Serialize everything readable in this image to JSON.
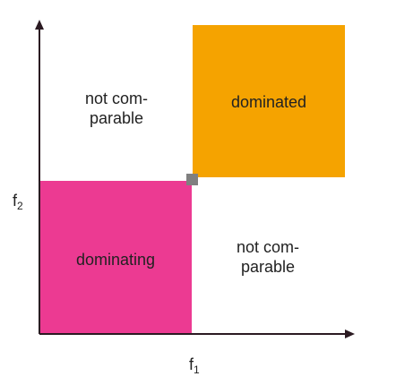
{
  "diagram": {
    "regions": {
      "not_comparable_top": {
        "line1": "not com-",
        "line2": "parable"
      },
      "dominated": {
        "label": "dominated",
        "color": "#F5A300"
      },
      "not_comparable_bottom": {
        "line1": "not com-",
        "line2": "parable"
      },
      "dominating": {
        "label": "dominating",
        "color": "#EC3A92"
      }
    },
    "reference_point": {
      "color": "#808080"
    },
    "axes": {
      "x_label": "f",
      "x_label_sub": "1",
      "y_label": "f",
      "y_label_sub": "2",
      "color": "#2B1A22"
    }
  }
}
